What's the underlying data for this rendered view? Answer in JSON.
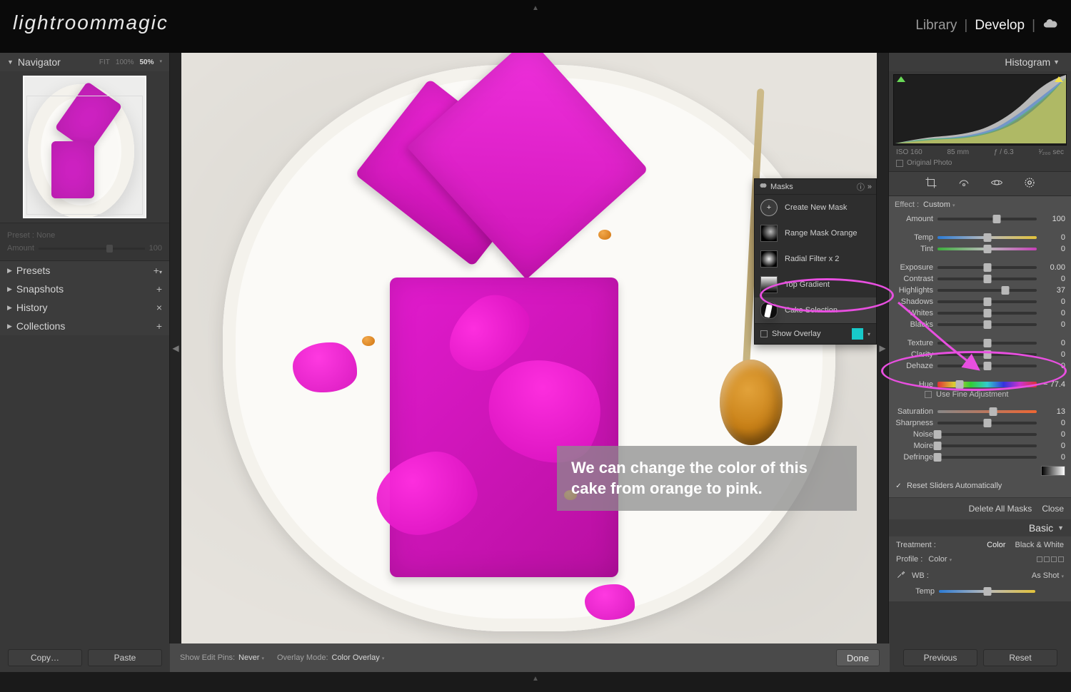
{
  "brand": "lightroommagic",
  "modules": {
    "library": "Library",
    "develop": "Develop"
  },
  "navigator": {
    "title": "Navigator",
    "zoom": {
      "fit": "FIT",
      "p100": "100%",
      "p50": "50%"
    }
  },
  "preset_block": {
    "preset_label": "Preset : None",
    "amount_label": "Amount",
    "amount_value": "100"
  },
  "left_sections": {
    "presets": "Presets",
    "snapshots": "Snapshots",
    "history": "History",
    "collections": "Collections"
  },
  "histogram": {
    "title": "Histogram"
  },
  "exif": {
    "iso": "ISO 160",
    "focal": "85 mm",
    "aperture": "ƒ / 6.3",
    "shutter": "¹⁄₂₀₀ sec"
  },
  "original_photo": "Original Photo",
  "effect": {
    "label": "Effect :",
    "value": "Custom"
  },
  "sliders": {
    "amount": {
      "label": "Amount",
      "value": "100",
      "pos": 60
    },
    "temp": {
      "label": "Temp",
      "value": "0",
      "pos": 50
    },
    "tint": {
      "label": "Tint",
      "value": "0",
      "pos": 50
    },
    "exposure": {
      "label": "Exposure",
      "value": "0.00",
      "pos": 50
    },
    "contrast": {
      "label": "Contrast",
      "value": "0",
      "pos": 50
    },
    "highlights": {
      "label": "Highlights",
      "value": "37",
      "pos": 68
    },
    "shadows": {
      "label": "Shadows",
      "value": "0",
      "pos": 50
    },
    "whites": {
      "label": "Whites",
      "value": "0",
      "pos": 50
    },
    "blacks": {
      "label": "Blacks",
      "value": "0",
      "pos": 50
    },
    "texture": {
      "label": "Texture",
      "value": "0",
      "pos": 50
    },
    "clarity": {
      "label": "Clarity",
      "value": "0",
      "pos": 50
    },
    "dehaze": {
      "label": "Dehaze",
      "value": "0",
      "pos": 50
    },
    "hue": {
      "label": "Hue",
      "value": "− 77.4",
      "pos": 22
    },
    "saturation": {
      "label": "Saturation",
      "value": "13",
      "pos": 56
    },
    "sharpness": {
      "label": "Sharpness",
      "value": "0",
      "pos": 50
    },
    "noise": {
      "label": "Noise",
      "value": "0",
      "pos": 0
    },
    "moire": {
      "label": "Moire",
      "value": "0",
      "pos": 0
    },
    "defringe": {
      "label": "Defringe",
      "value": "0",
      "pos": 0
    }
  },
  "fine_adjust": "Use Fine Adjustment",
  "reset_auto": "Reset Sliders Automatically",
  "mask_footer": {
    "delete": "Delete All Masks",
    "close": "Close"
  },
  "basic": {
    "title": "Basic",
    "treatment_label": "Treatment :",
    "color": "Color",
    "bw": "Black & White",
    "profile_label": "Profile :",
    "profile_value": "Color",
    "wb_label": "WB :",
    "wb_value": "As Shot",
    "temp_label": "Temp"
  },
  "masks_panel": {
    "title": "Masks",
    "create": "Create New Mask",
    "items": [
      {
        "label": "Range Mask Orange"
      },
      {
        "label": "Radial Filter x 2"
      },
      {
        "label": "Top Gradient"
      },
      {
        "label": "Cake Selection"
      }
    ],
    "show_overlay": "Show Overlay"
  },
  "caption": "We can change the color of this cake from orange to pink.",
  "toolbar": {
    "show_pins_label": "Show Edit Pins:",
    "show_pins_value": "Never",
    "overlay_label": "Overlay Mode:",
    "overlay_value": "Color Overlay",
    "done": "Done"
  },
  "buttons": {
    "copy": "Copy…",
    "paste": "Paste",
    "previous": "Previous",
    "reset": "Reset"
  }
}
